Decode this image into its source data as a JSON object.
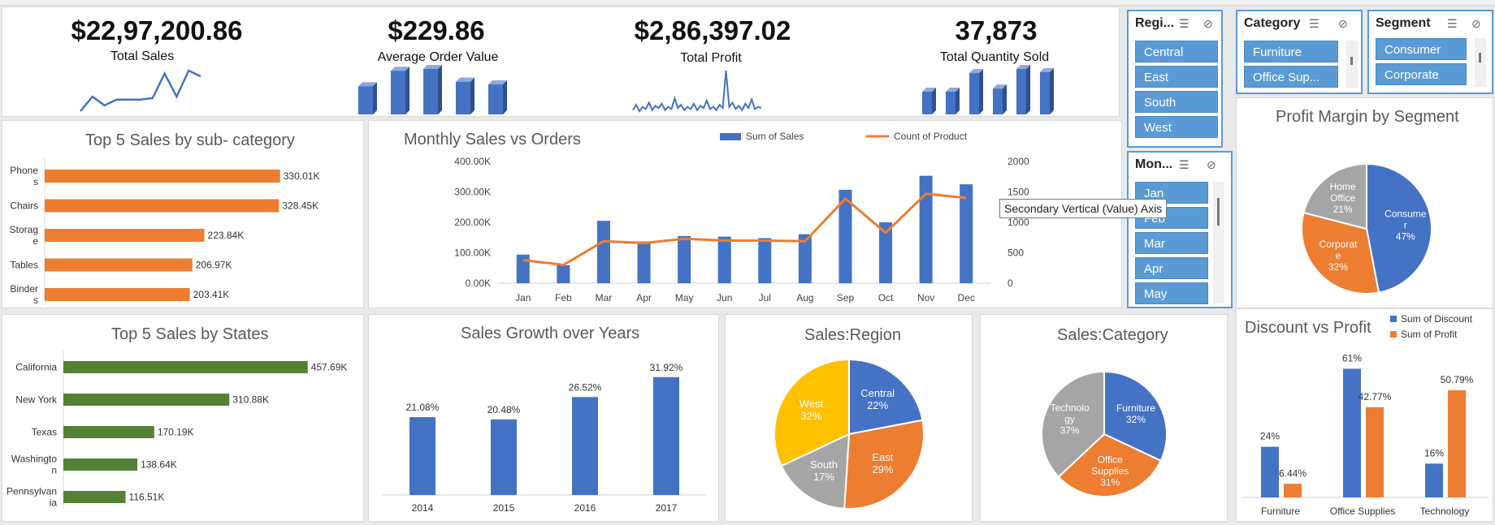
{
  "kpis": [
    {
      "value": "$22,97,200.86",
      "label": "Total Sales"
    },
    {
      "value": "$229.86",
      "label": "Average Order Value"
    },
    {
      "value": "$2,86,397.02",
      "label": "Total Profit"
    },
    {
      "value": "37,873",
      "label": "Total Quantity Sold"
    }
  ],
  "slicers": {
    "region": {
      "title": "Regi...",
      "items": [
        "Central",
        "East",
        "South",
        "West"
      ]
    },
    "category": {
      "title": "Category",
      "items": [
        "Furniture",
        "Office Sup..."
      ]
    },
    "segment": {
      "title": "Segment",
      "items": [
        "Consumer",
        "Corporate"
      ]
    },
    "month": {
      "title": "Mon...",
      "items": [
        "Jan",
        "Feb",
        "Mar",
        "Apr",
        "May"
      ]
    }
  },
  "tooltip": "Secondary Vertical (Value) Axis",
  "colors": {
    "blue": "#4472c4",
    "orange": "#ed7d31",
    "green": "#548235",
    "gray": "#a5a5a5",
    "yellow": "#ffc000",
    "slicer": "#5b9bd5"
  },
  "chart_data": [
    {
      "id": "subcat",
      "type": "bar",
      "orientation": "horizontal",
      "title": "Top 5 Sales by sub- category",
      "categories": [
        "Phones",
        "Chairs",
        "Storage",
        "Tables",
        "Binders"
      ],
      "category_lines": [
        [
          "Phone",
          "s"
        ],
        [
          "Chairs"
        ],
        [
          "Storag",
          "e"
        ],
        [
          "Tables"
        ],
        [
          "Binder",
          "s"
        ]
      ],
      "values": [
        330.01,
        328.45,
        223.84,
        206.97,
        203.41
      ],
      "labels": [
        "330.01K",
        "328.45K",
        "223.84K",
        "206.97K",
        "203.41K"
      ],
      "unit": "K"
    },
    {
      "id": "monthly",
      "type": "bar+line",
      "title": "Monthly Sales vs Orders",
      "categories": [
        "Jan",
        "Feb",
        "Mar",
        "Apr",
        "May",
        "Jun",
        "Jul",
        "Aug",
        "Sep",
        "Oct",
        "Nov",
        "Dec"
      ],
      "series": [
        {
          "name": "Sum of Sales",
          "type": "bar",
          "axis": "primary",
          "values": [
            94,
            59,
            205,
            137,
            155,
            153,
            148,
            161,
            307,
            200,
            353,
            325
          ]
        },
        {
          "name": "Count of Product",
          "type": "line",
          "axis": "secondary",
          "values": [
            380,
            300,
            690,
            660,
            730,
            700,
            700,
            690,
            1390,
            830,
            1470,
            1400
          ]
        }
      ],
      "yticks": [
        "0.00K",
        "100.00K",
        "200.00K",
        "300.00K",
        "400.00K"
      ],
      "ylim": [
        0,
        400
      ],
      "y2ticks": [
        "0",
        "500",
        "1000",
        "1500",
        "2000"
      ],
      "y2lim": [
        0,
        2000
      ]
    },
    {
      "id": "states",
      "type": "bar",
      "orientation": "horizontal",
      "title": "Top 5 Sales by States",
      "categories": [
        "California",
        "New York",
        "Texas",
        "Washington",
        "Pennsylvania"
      ],
      "category_lines": [
        [
          "California"
        ],
        [
          "New York"
        ],
        [
          "Texas"
        ],
        [
          "Washingto",
          "n"
        ],
        [
          "Pennsylvan",
          "ia"
        ]
      ],
      "values": [
        457.69,
        310.88,
        170.19,
        138.64,
        116.51
      ],
      "labels": [
        "457.69K",
        "310.88K",
        "170.19K",
        "138.64K",
        "116.51K"
      ],
      "unit": "K"
    },
    {
      "id": "growth",
      "type": "bar",
      "title": "Sales Growth over Years",
      "categories": [
        "2014",
        "2015",
        "2016",
        "2017"
      ],
      "values": [
        21.08,
        20.48,
        26.52,
        31.92
      ],
      "labels": [
        "21.08%",
        "20.48%",
        "26.52%",
        "31.92%"
      ]
    },
    {
      "id": "region",
      "type": "pie",
      "title": "Sales:Region",
      "slices": [
        {
          "name": "Central",
          "lines": [
            "Central"
          ],
          "pct": 22,
          "label": "22%",
          "color": "#4472c4"
        },
        {
          "name": "East",
          "lines": [
            "East"
          ],
          "pct": 29,
          "label": "29%",
          "color": "#ed7d31"
        },
        {
          "name": "South",
          "lines": [
            "South"
          ],
          "pct": 17,
          "label": "17%",
          "color": "#a5a5a5"
        },
        {
          "name": "West",
          "lines": [
            "West"
          ],
          "pct": 32,
          "label": "32%",
          "color": "#ffc000"
        }
      ]
    },
    {
      "id": "category",
      "type": "pie",
      "title": "Sales:Category",
      "slices": [
        {
          "name": "Furniture",
          "lines": [
            "Furniture"
          ],
          "pct": 32,
          "label": "32%",
          "color": "#4472c4"
        },
        {
          "name": "Office Supplies",
          "lines": [
            "Office",
            "Supplies"
          ],
          "pct": 31,
          "label": "31%",
          "color": "#ed7d31"
        },
        {
          "name": "Technology",
          "lines": [
            "Technolo",
            "gy"
          ],
          "pct": 37,
          "label": "37%",
          "color": "#a5a5a5"
        }
      ]
    },
    {
      "id": "segment",
      "type": "pie",
      "title": "Profit Margin by Segment",
      "slices": [
        {
          "name": "Consumer",
          "lines": [
            "Consume",
            "r"
          ],
          "pct": 47,
          "label": "47%",
          "color": "#4472c4"
        },
        {
          "name": "Corporate",
          "lines": [
            "Corporat",
            "e"
          ],
          "pct": 32,
          "label": "32%",
          "color": "#ed7d31"
        },
        {
          "name": "Home Office",
          "lines": [
            "Home",
            "Office"
          ],
          "pct": 21,
          "label": "21%",
          "color": "#a5a5a5"
        }
      ]
    },
    {
      "id": "discount",
      "type": "bar",
      "title": "Discount vs Profit",
      "categories": [
        "Furniture",
        "Office Supplies",
        "Technology"
      ],
      "series": [
        {
          "name": "Sum of Discount",
          "values": [
            24,
            61,
            16
          ],
          "labels": [
            "24%",
            "61%",
            "16%"
          ]
        },
        {
          "name": "Sum of Profit",
          "values": [
            6.44,
            42.77,
            50.79
          ],
          "labels": [
            "6.44%",
            "42.77%",
            "50.79%"
          ]
        }
      ],
      "legend": "top-right"
    },
    {
      "id": "spark_sales",
      "type": "line",
      "values": [
        2,
        12,
        6,
        10,
        10,
        10,
        11,
        28,
        12,
        30,
        26
      ]
    },
    {
      "id": "spark_aov",
      "type": "bar",
      "values": [
        31,
        48,
        50,
        36,
        33
      ]
    },
    {
      "id": "spark_profit",
      "type": "line",
      "values": [
        3,
        8,
        2,
        6,
        4,
        10,
        3,
        7,
        5,
        9,
        3,
        6,
        4,
        14,
        5,
        8,
        3,
        6,
        4,
        9,
        3,
        7,
        5,
        12,
        4,
        6,
        3,
        8,
        5,
        40,
        6,
        10,
        4,
        7,
        3,
        9,
        5,
        13,
        4,
        6,
        5
      ]
    },
    {
      "id": "spark_qty",
      "type": "bar",
      "values": [
        22,
        22,
        40,
        25,
        44,
        41
      ]
    }
  ]
}
